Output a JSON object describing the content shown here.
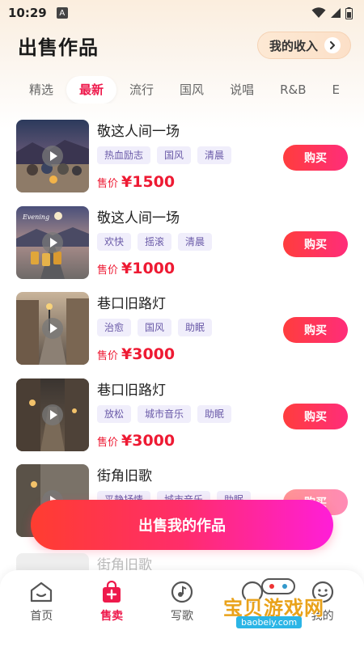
{
  "status_bar": {
    "time": "10:29",
    "a_icon": "A"
  },
  "header": {
    "title": "出售作品",
    "income_label": "我的收入"
  },
  "tabs": [
    {
      "label": "精选",
      "active": false
    },
    {
      "label": "最新",
      "active": true
    },
    {
      "label": "流行",
      "active": false
    },
    {
      "label": "国风",
      "active": false
    },
    {
      "label": "说唱",
      "active": false
    },
    {
      "label": "R&B",
      "active": false
    },
    {
      "label": "E",
      "active": false
    }
  ],
  "items": [
    {
      "title": "敬这人间一场",
      "tags": [
        "热血励志",
        "国风",
        "清晨"
      ],
      "price_label": "售价",
      "price": "¥1500",
      "buy": "购买"
    },
    {
      "title": "敬这人间一场",
      "tags": [
        "欢快",
        "摇滚",
        "清晨"
      ],
      "price_label": "售价",
      "price": "¥1000",
      "buy": "购买"
    },
    {
      "title": "巷口旧路灯",
      "tags": [
        "治愈",
        "国风",
        "助眠"
      ],
      "price_label": "售价",
      "price": "¥3000",
      "buy": "购买"
    },
    {
      "title": "巷口旧路灯",
      "tags": [
        "放松",
        "城市音乐",
        "助眠"
      ],
      "price_label": "售价",
      "price": "¥3000",
      "buy": "购买"
    },
    {
      "title": "街角旧歌",
      "tags": [
        "平静抒情",
        "城市音乐",
        "助眠"
      ],
      "price_label": "售价",
      "price": "",
      "buy": "购买"
    }
  ],
  "ghost_title": "街角旧歌",
  "sell_button": "出售我的作品",
  "bottom_nav": [
    {
      "label": "首页",
      "icon": "home-icon",
      "active": false
    },
    {
      "label": "售卖",
      "icon": "sell-bag-icon",
      "active": true
    },
    {
      "label": "写歌",
      "icon": "write-song-icon",
      "active": false
    },
    {
      "label": "",
      "icon": "message-icon",
      "active": false
    },
    {
      "label": "我的",
      "icon": "profile-icon",
      "active": false
    }
  ],
  "watermark": {
    "text": "宝贝游戏网",
    "url": "baobeiy.com"
  },
  "colors": {
    "accent": "#ee1a4c",
    "price": "#ee1a33",
    "tag_text": "#6a5aa8",
    "tag_bg": "#f0eefb"
  }
}
